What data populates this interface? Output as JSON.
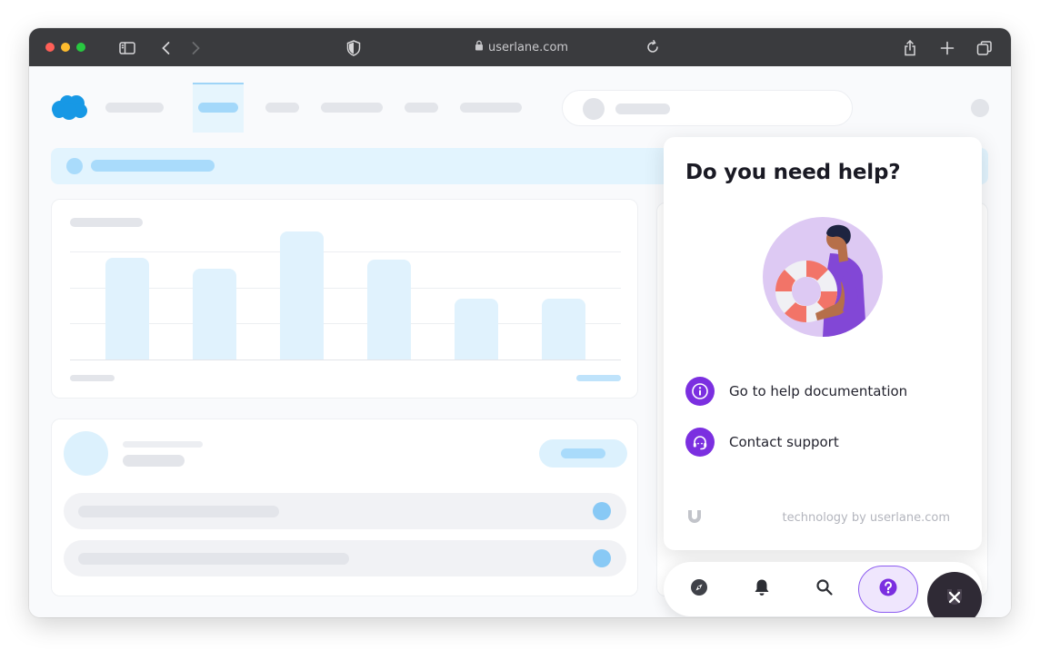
{
  "browser": {
    "url": "userlane.com",
    "icons": [
      "sidebar-icon",
      "back-icon",
      "forward-icon",
      "shield-icon",
      "lock-icon",
      "reload-icon",
      "share-icon",
      "new-tab-icon",
      "tabs-icon"
    ]
  },
  "app": {
    "brand": "salesforce-cloud-logo",
    "accent": "#7b2fe0"
  },
  "help_panel": {
    "title": "Do you need help?",
    "items": [
      {
        "label": "Go to help documentation",
        "icon": "info-icon"
      },
      {
        "label": "Contact support",
        "icon": "headset-icon"
      }
    ],
    "footer": "technology by userlane.com"
  },
  "dock": {
    "buttons": [
      {
        "name": "compass-icon"
      },
      {
        "name": "bell-icon"
      },
      {
        "name": "search-icon"
      },
      {
        "name": "help-icon",
        "active": true
      }
    ],
    "close": "close-icon"
  }
}
